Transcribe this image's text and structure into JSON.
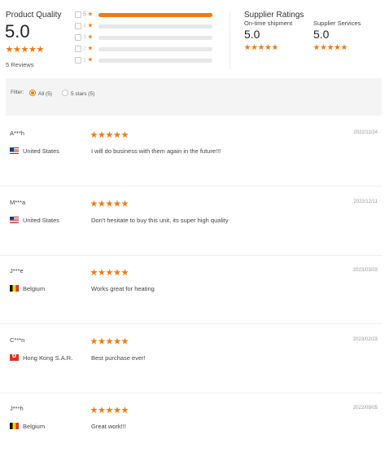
{
  "summary": {
    "product_quality_label": "Product Quality",
    "product_quality_score": "5.0",
    "reviews_count": "5 Reviews",
    "breakdown": [
      {
        "label": "5",
        "fill_fraction": 1.0
      },
      {
        "label": "4",
        "fill_fraction": 0.0
      },
      {
        "label": "3",
        "fill_fraction": 0.0
      },
      {
        "label": "2",
        "fill_fraction": 0.0
      },
      {
        "label": "1",
        "fill_fraction": 0.0
      }
    ],
    "supplier_ratings_label": "Supplier Ratings",
    "on_time_label": "On-time shipment",
    "on_time_score": "5.0",
    "services_label": "Supplier Services",
    "services_score": "5.0",
    "accent_color": "#f07a12"
  },
  "filter": {
    "label": "Filter:",
    "options": [
      {
        "label": "All (5)",
        "selected": true
      },
      {
        "label": "5 stars (5)",
        "selected": false
      }
    ]
  },
  "reviews": [
    {
      "user": "A***h",
      "country": "United States",
      "flag": "us-flag-icon",
      "stars": 5,
      "date": "2022/11/24",
      "text": "I will do business with them again in the future!!!"
    },
    {
      "user": "M***a",
      "country": "United States",
      "flag": "us-flag-icon",
      "stars": 5,
      "date": "2022/12/11",
      "text": "Don't hesitate to buy this unit, its super high quality"
    },
    {
      "user": "J***e",
      "country": "Belgium",
      "flag": "be-flag-icon",
      "stars": 5,
      "date": "2023/03/03",
      "text": "Works great for heating"
    },
    {
      "user": "C***n",
      "country": "Hong Kong S.A.R.",
      "flag": "hk-flag-icon",
      "stars": 5,
      "date": "2023/02/23",
      "text": "Best purchase ever!"
    },
    {
      "user": "J***h",
      "country": "Belgium",
      "flag": "be-flag-icon",
      "stars": 5,
      "date": "2022/09/05",
      "text": "Great work!!!"
    }
  ]
}
